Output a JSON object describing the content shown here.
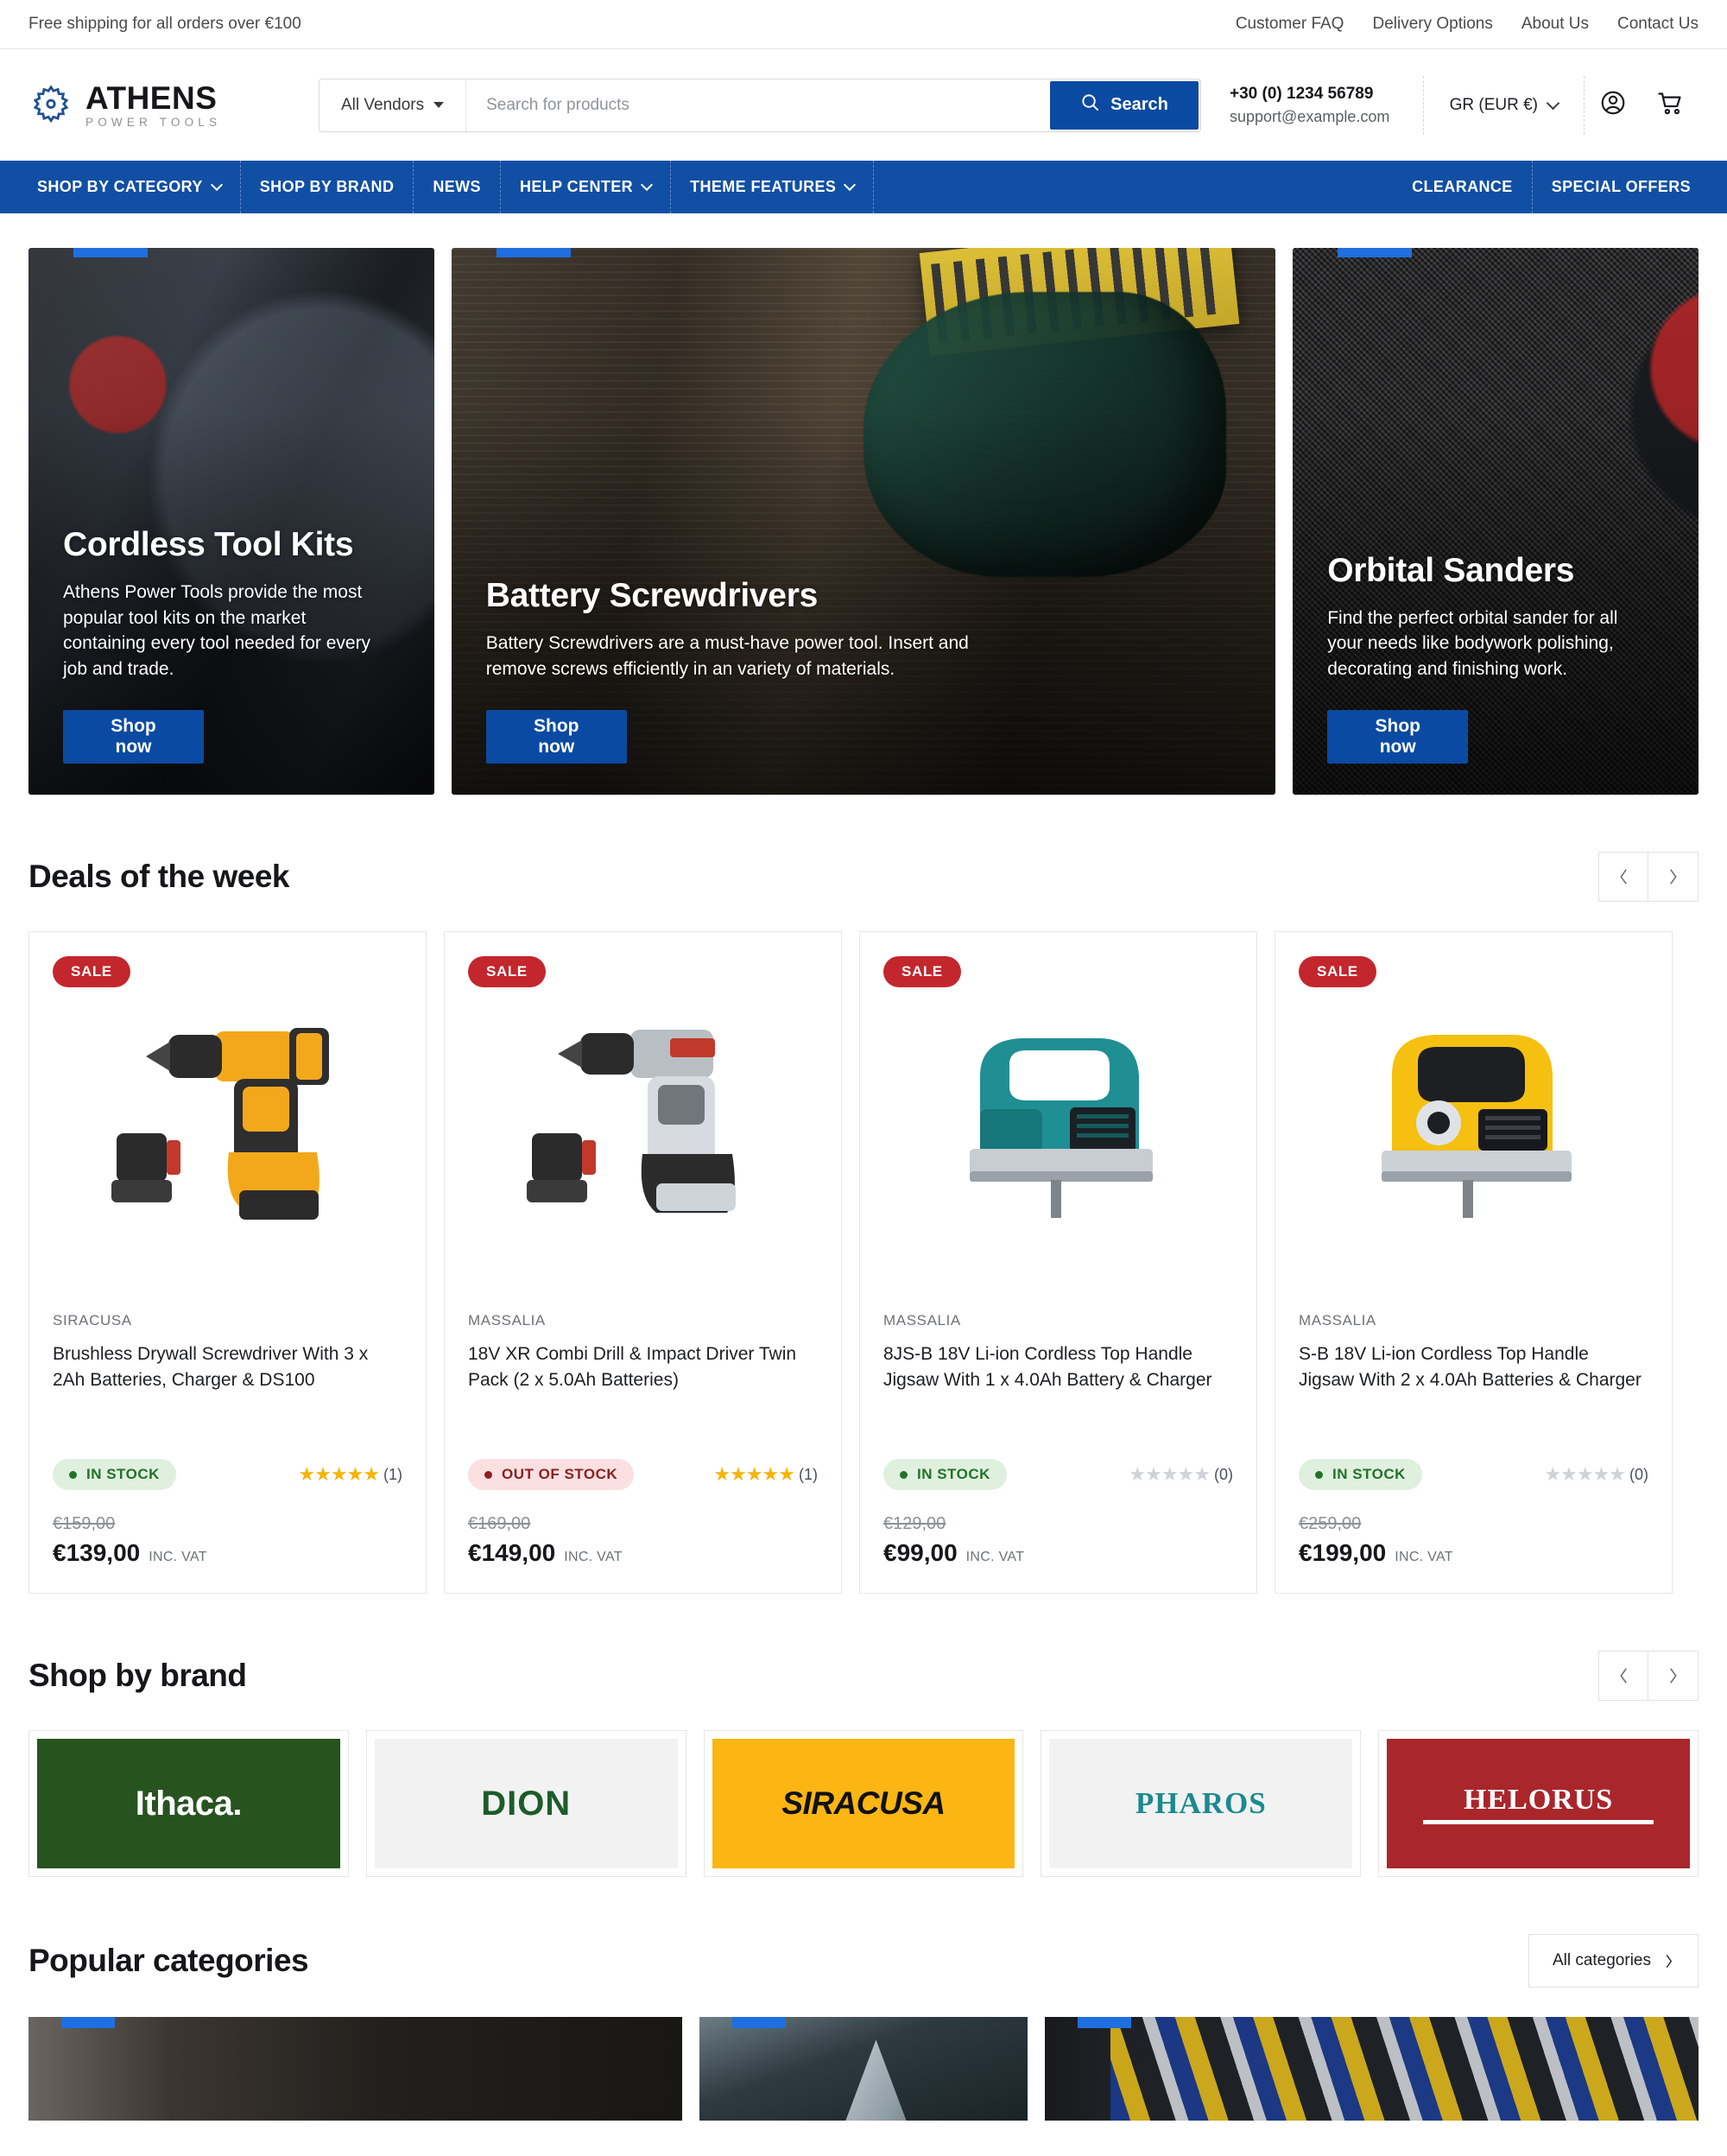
{
  "announcement": {
    "message": "Free shipping for all orders over €100",
    "links": [
      "Customer FAQ",
      "Delivery Options",
      "About Us",
      "Contact Us"
    ]
  },
  "header": {
    "logo_name": "ATHENS",
    "logo_tagline": "POWER TOOLS",
    "logo_icon": "gear-icon",
    "search": {
      "vendor_label": "All Vendors",
      "placeholder": "Search for products",
      "value": "",
      "button_label": "Search",
      "button_icon": "search-icon"
    },
    "contact": {
      "phone": "+30 (0) 1234 56789",
      "email": "support@example.com"
    },
    "currency": "GR (EUR €)",
    "account_icon": "user-account-icon",
    "cart_icon": "shopping-cart-icon"
  },
  "nav": {
    "left_items": [
      {
        "label": "SHOP BY CATEGORY",
        "has_caret": true
      },
      {
        "label": "SHOP BY BRAND",
        "has_caret": false
      },
      {
        "label": "NEWS",
        "has_caret": false
      },
      {
        "label": "HELP CENTER",
        "has_caret": true
      },
      {
        "label": "THEME FEATURES",
        "has_caret": true
      }
    ],
    "right_items": [
      {
        "label": "CLEARANCE"
      },
      {
        "label": "SPECIAL OFFERS"
      }
    ]
  },
  "hero": {
    "cards": [
      {
        "title": "Cordless Tool Kits",
        "description": "Athens Power Tools provide the most popular tool kits on the market containing every tool needed for every job and trade.",
        "button": "Shop now"
      },
      {
        "title": "Battery Screwdrivers",
        "description": "Battery Screwdrivers are a must-have power tool. Insert and remove screws efficiently in an variety of materials.",
        "button": "Shop now"
      },
      {
        "title": "Orbital Sanders",
        "description": "Find the perfect orbital sander for all your needs like bodywork polishing, decorating and finishing work.",
        "button": "Shop now"
      }
    ]
  },
  "deals": {
    "title": "Deals of the week",
    "prev_icon": "chevron-left-icon",
    "next_icon": "chevron-right-icon",
    "products": [
      {
        "badge": "SALE",
        "brand": "SIRACUSA",
        "name": "Brushless Drywall Screwdriver With 3 x 2Ah Batteries, Charger & DS100",
        "stock": "IN STOCK",
        "in_stock": true,
        "stars": 5,
        "review_count": "(1)",
        "old_price": "€159,00",
        "price": "€139,00",
        "vat": "INC. VAT"
      },
      {
        "badge": "SALE",
        "brand": "MASSALIA",
        "name": "18V XR Combi Drill & Impact Driver Twin Pack (2 x 5.0Ah Batteries)",
        "stock": "OUT OF STOCK",
        "in_stock": false,
        "stars": 5,
        "review_count": "(1)",
        "old_price": "€169,00",
        "price": "€149,00",
        "vat": "INC. VAT"
      },
      {
        "badge": "SALE",
        "brand": "MASSALIA",
        "name": "8JS-B 18V Li-ion Cordless Top Handle Jigsaw With 1 x 4.0Ah Battery & Charger",
        "stock": "IN STOCK",
        "in_stock": true,
        "stars": 0,
        "review_count": "(0)",
        "old_price": "€129,00",
        "price": "€99,00",
        "vat": "INC. VAT"
      },
      {
        "badge": "SALE",
        "brand": "MASSALIA",
        "name": "S-B 18V Li-ion Cordless Top Handle Jigsaw With 2 x 4.0Ah Batteries & Charger",
        "stock": "IN STOCK",
        "in_stock": true,
        "stars": 0,
        "review_count": "(0)",
        "old_price": "€259,00",
        "price": "€199,00",
        "vat": "INC. VAT"
      }
    ]
  },
  "brands": {
    "title": "Shop by brand",
    "prev_icon": "chevron-left-icon",
    "next_icon": "chevron-right-icon",
    "items": [
      {
        "name": "Ithaca.",
        "bg": "#27531f",
        "fg": "#ffffff"
      },
      {
        "name": "DION",
        "bg": "#f2f2f2",
        "fg": "#1d5c2a"
      },
      {
        "name": "SIRACUSA",
        "bg": "#fcb613",
        "fg": "#111111"
      },
      {
        "name": "PHAROS",
        "bg": "#f2f2f2",
        "fg": "#1b8a8f"
      },
      {
        "name": "HELORUS",
        "bg": "#a9262b",
        "fg": "#ffffff"
      }
    ]
  },
  "categories": {
    "title": "Popular categories",
    "all_label": "All categories",
    "all_icon": "chevron-right-icon"
  },
  "colors": {
    "brand_blue": "#114fa5",
    "button_blue": "#0b4aa2",
    "sale_red": "#c3262c",
    "in_stock_green": "#23722a",
    "out_stock_red": "#8d1f23",
    "star_gold": "#f5b50a"
  }
}
